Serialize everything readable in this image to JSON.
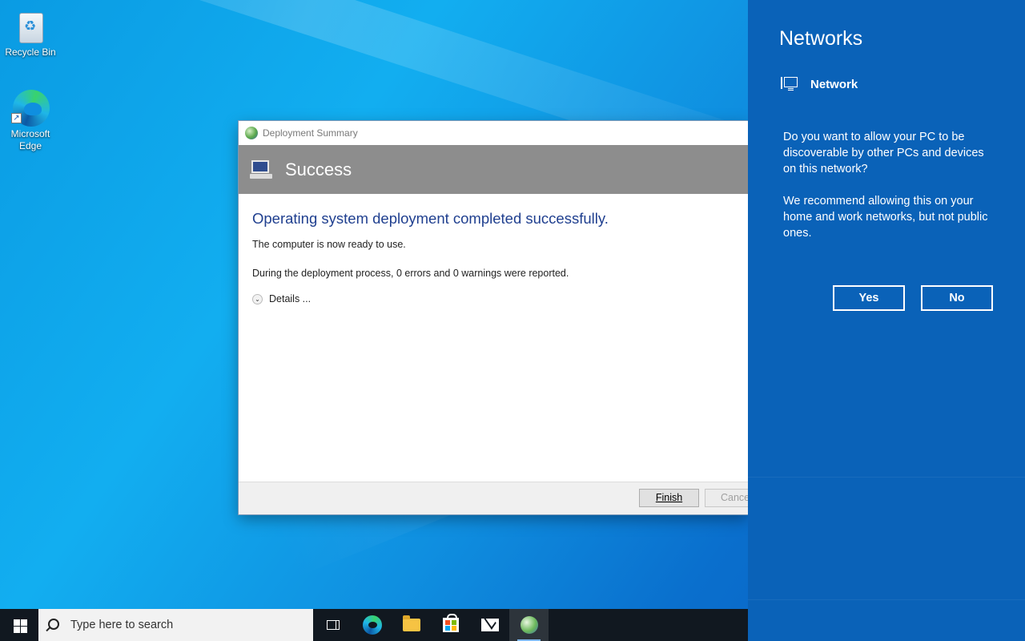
{
  "desktop": {
    "icons": [
      {
        "label": "Recycle Bin",
        "icon": "recycle-bin-icon"
      },
      {
        "label": "Microsoft Edge",
        "icon": "edge-icon"
      }
    ]
  },
  "window": {
    "title": "Deployment Summary",
    "band_title": "Success",
    "headline": "Operating system deployment completed successfully.",
    "line1": "The computer is now ready to use.",
    "line2": "During the deployment process, 0 errors and 0 warnings were reported.",
    "details_label": "Details ...",
    "finish_label": "Finish",
    "cancel_label": "Cance",
    "colors": {
      "band": "#8d8d8d",
      "headline": "#1f3f8f"
    }
  },
  "networks": {
    "title": "Networks",
    "network_name": "Network",
    "question": "Do you want to allow your PC to be discoverable by other PCs and devices on this network?",
    "recommendation": "We recommend allowing this on your home and work networks, but not public ones.",
    "yes_label": "Yes",
    "no_label": "No",
    "background": "#0a62b8"
  },
  "taskbar": {
    "search_placeholder": "Type here to search",
    "pinned": [
      "task-view-icon",
      "edge-icon",
      "file-explorer-icon",
      "store-icon",
      "mail-icon",
      "deployment-icon"
    ]
  }
}
